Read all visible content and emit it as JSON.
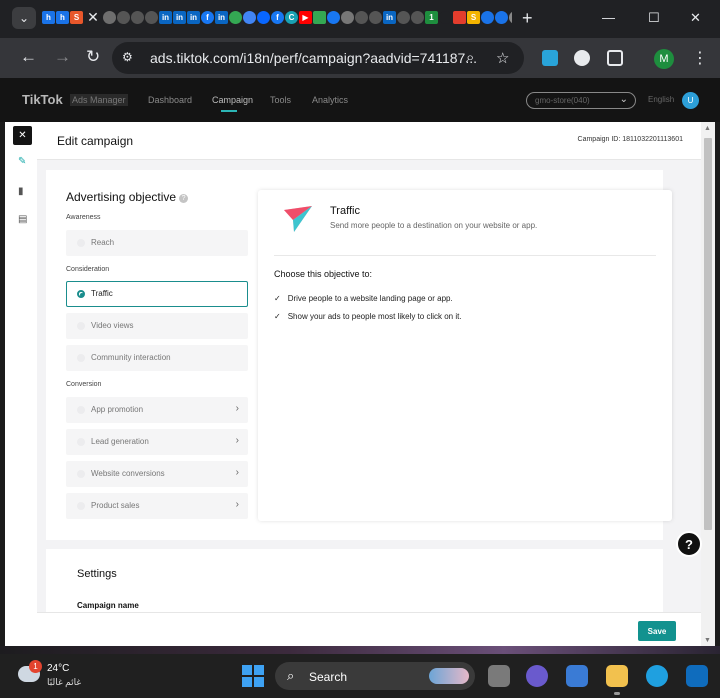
{
  "browser": {
    "url": "ads.tiktok.com/i18n/perf/campaign?aadvid=741187...",
    "tab_close": "✕",
    "new_tab": "+",
    "profile_initial": "M"
  },
  "appnav": {
    "logo": "TikTok",
    "logo_sub": "Ads Manager",
    "links": [
      "Dashboard",
      "Campaign",
      "Tools",
      "Analytics"
    ],
    "active_link": "Campaign",
    "account": "gmo-store(040)",
    "language": "English",
    "user_initial": "U",
    "accent_color": "#2cb5b5"
  },
  "panel": {
    "title": "Edit campaign",
    "campaign_id": "Campaign ID: 1811032201113601"
  },
  "objective": {
    "heading": "Advertising objective",
    "groups": {
      "awareness": "Awareness",
      "consideration": "Consideration",
      "conversion": "Conversion"
    },
    "options": {
      "reach": "Reach",
      "traffic": "Traffic",
      "video_views": "Video views",
      "community": "Community interaction",
      "app_promotion": "App promotion",
      "lead_generation": "Lead generation",
      "website_conversions": "Website conversions",
      "product_sales": "Product sales"
    },
    "selected": "Traffic",
    "detail": {
      "title": "Traffic",
      "description": "Send more people to a destination on your website or app.",
      "choose_heading": "Choose this objective to:",
      "bullets": [
        "Drive people to a website landing page or app.",
        "Show your ads to people most likely to click on it."
      ]
    }
  },
  "settings": {
    "title": "Settings",
    "campaign_name_label": "Campaign name"
  },
  "footer": {
    "save_label": "Save",
    "save_color": "#12928f"
  },
  "help": "?",
  "taskbar": {
    "weather_badge": "1",
    "temperature": "24°C",
    "weather_text": "غائم غالبًا",
    "search_label": "Search"
  }
}
